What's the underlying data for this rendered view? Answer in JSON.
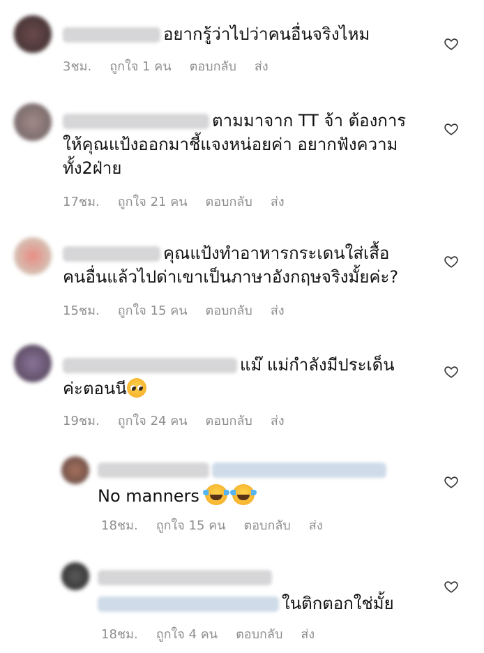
{
  "comments": [
    {
      "text": "อยากรู้ว่าไปว่าคนอื่นจริงไหม",
      "time": "3ชม.",
      "likes": "ถูกใจ 1 คน",
      "reply": "ตอบกลับ",
      "send": "ส่ง"
    },
    {
      "text_line1": "ตามมาจาก TT จ้า ต้องการ",
      "text_line2": "ให้คุณแป้งออกมาชี้แจงหน่อยค่า อยากฟังความ",
      "text_line3": "ทั้ง2ฝ่าย",
      "time": "17ชม.",
      "likes": "ถูกใจ 21 คน",
      "reply": "ตอบกลับ",
      "send": "ส่ง"
    },
    {
      "text_line1": "คุณแป้งทำอาหารกระเดนใส่เสื้อ",
      "text_line2": "คนอื่นแล้วไปด่าเขาเป็นภาษาอังกฤษจริงมั้ยค่ะ?",
      "time": "15ชม.",
      "likes": "ถูกใจ 15 คน",
      "reply": "ตอบกลับ",
      "send": "ส่ง"
    },
    {
      "text_line1": "แม๊  แม่กำลังมีประเด็น",
      "text_line2": "ค่ะตอนนี",
      "emoji": "pleading-face-emoji",
      "time": "19ชม.",
      "likes": "ถูกใจ 24 คน",
      "reply": "ตอบกลับ",
      "send": "ส่ง"
    },
    {
      "text": "No manners",
      "emoji": "tears-of-joy-emoji",
      "time": "18ชม.",
      "likes": "ถูกใจ 15 คน",
      "reply": "ตอบกลับ",
      "send": "ส่ง"
    },
    {
      "text": "ในติกตอกใช่มั้ย",
      "time": "18ชม.",
      "likes": "ถูกใจ 4 คน",
      "reply": "ตอบกลับ",
      "send": "ส่ง"
    }
  ],
  "icons": {
    "like": "heart-outline-icon"
  },
  "colors": {
    "meta": "#8e8e8e",
    "text": "#111111"
  }
}
